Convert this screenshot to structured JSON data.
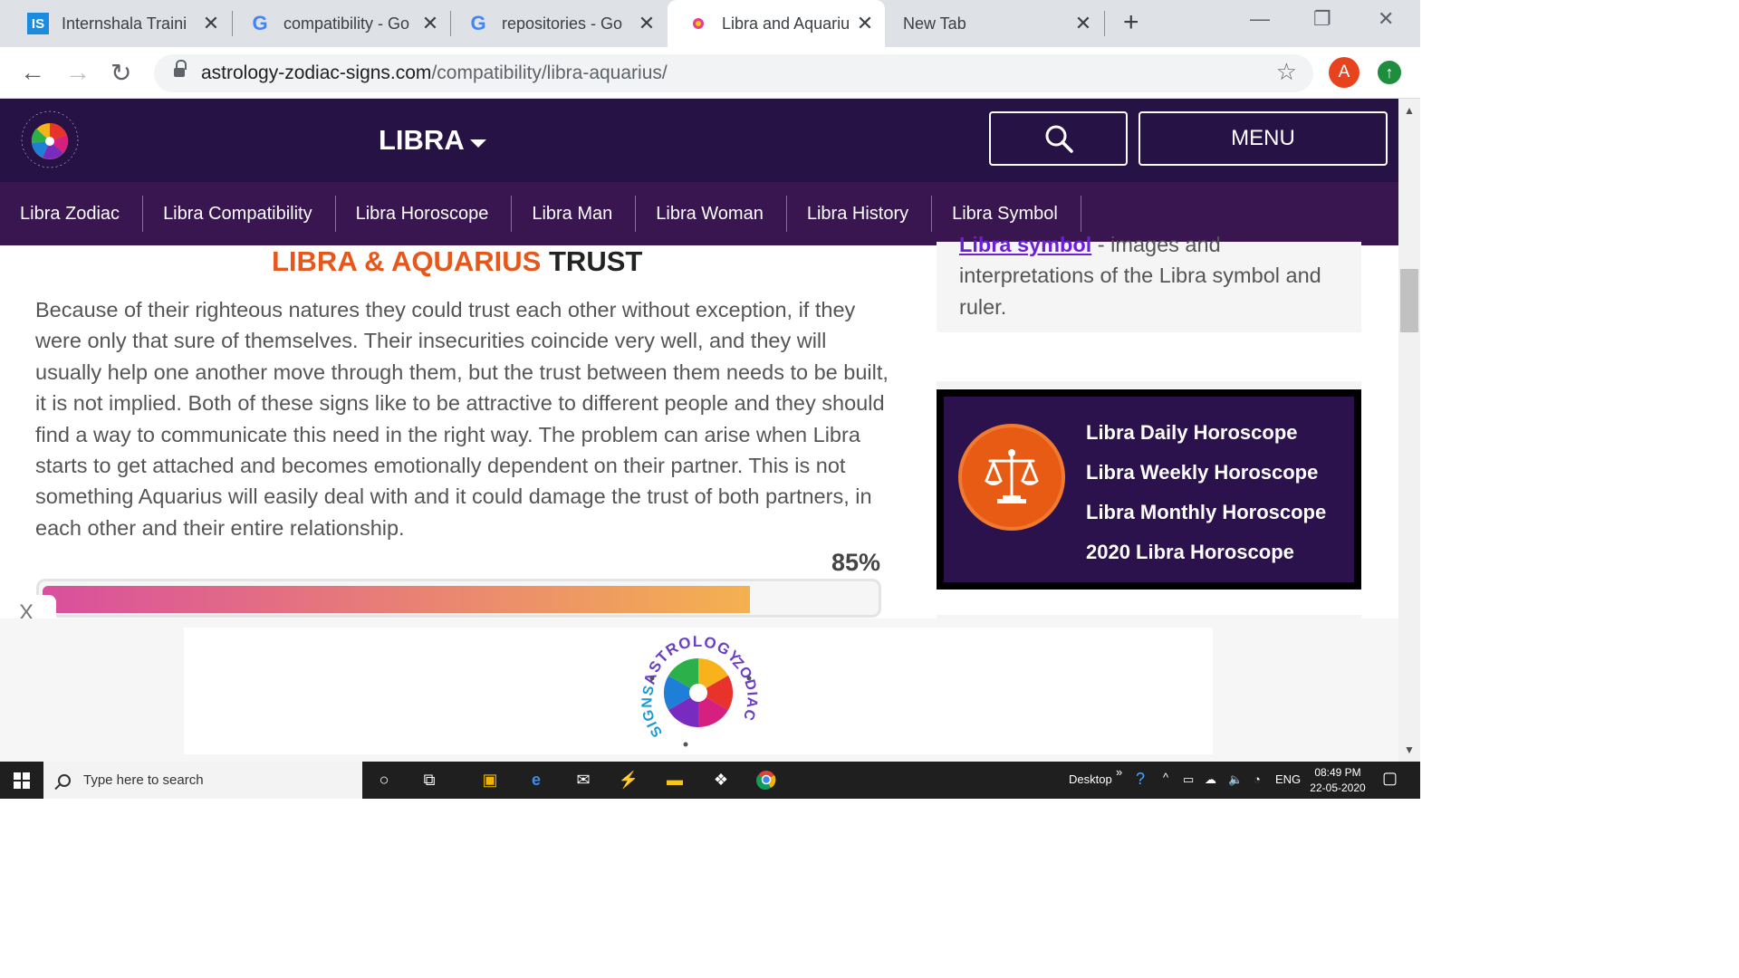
{
  "browser": {
    "tabs": [
      {
        "title": "Internshala Traini",
        "icon": "internshala-icon"
      },
      {
        "title": "compatibility - Go",
        "icon": "google-icon"
      },
      {
        "title": "repositories - Go",
        "icon": "google-icon"
      },
      {
        "title": "Libra and Aquarius",
        "icon": "zodiac-icon",
        "active": true
      },
      {
        "title": "New Tab",
        "icon": ""
      }
    ],
    "url_host": "astrology-zodiac-signs.com",
    "url_path": "/compatibility/libra-aquarius/",
    "profile_initial": "A"
  },
  "site": {
    "brand": "LIBRA",
    "menu_label": "MENU",
    "subnav": [
      "Libra Zodiac",
      "Libra Compatibility",
      "Libra Horoscope",
      "Libra Man",
      "Libra Woman",
      "Libra History",
      "Libra Symbol"
    ]
  },
  "main": {
    "heading_highlight": "LIBRA & AQUARIUS",
    "heading_rest": "TRUST",
    "paragraph": "Because of their righteous natures they could trust each other without exception, if they were only that sure of themselves. Their insecurities coincide very well, and they will usually help one another move through them, but the trust between them needs to be built, it is not implied. Both of these signs like to be attractive to different people and they should find a way to communicate this need in the right way. The problem can arise when Libra starts to get attached and becomes emotionally dependent on their partner. This is not something Aquarius will easily deal with and it could damage the trust of both partners, in each other and their entire relationship.",
    "trust_percent_label": "85%",
    "trust_percent": 85
  },
  "sidebar": {
    "symbol_link": "Libra symbol",
    "symbol_desc": " - images and interpretations of the Libra symbol and ruler.",
    "horoscope_links": [
      "Libra Daily Horoscope",
      "Libra Weekly Horoscope",
      "Libra Monthly Horoscope",
      "2020 Libra Horoscope"
    ]
  },
  "ad": {
    "close_label": "X",
    "logo_text_top": "ASTROLOGY",
    "logo_text_right": "ZODIAC",
    "logo_text_left": "SIGNS"
  },
  "taskbar": {
    "search_placeholder": "Type here to search",
    "desktop_label": "Desktop",
    "language": "ENG",
    "time": "08:49 PM",
    "date": "22-05-2020"
  },
  "colors": {
    "header_bg": "#271245",
    "subnav_bg": "#3a1650",
    "accent_orange": "#e5571b",
    "link_purple": "#6b1fd6"
  }
}
